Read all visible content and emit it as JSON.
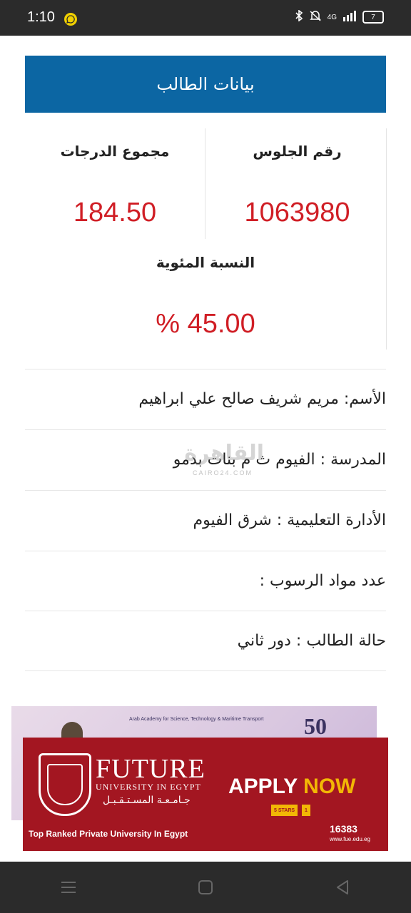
{
  "status_bar": {
    "time": "1:10",
    "battery": "7",
    "network": "4G"
  },
  "header": {
    "title": "بيانات الطالب"
  },
  "stats": {
    "seat_number_label": "رقم الجلوس",
    "seat_number_value": "1063980",
    "total_label": "مجموع الدرجات",
    "total_value": "184.50",
    "percent_label": "النسبة المئوية",
    "percent_value": "% 45.00"
  },
  "details": [
    {
      "text": "الأسم: مريم شريف صالح علي ابراهيم"
    },
    {
      "text": "المدرسة : الفيوم ث م بنات بدمو"
    },
    {
      "text": "الأدارة التعليمية : شرق الفيوم"
    },
    {
      "text": "عدد مواد الرسوب :"
    },
    {
      "text": "حالة الطالب : دور ثاني"
    }
  ],
  "watermark": {
    "text": "القاهرة",
    "sub": "CAIRO24.COM"
  },
  "ad": {
    "back_number": "50",
    "back_text": "Arab Academy for Science, Technology & Maritime Transport",
    "brand": "FUTURE",
    "university": "UNIVERSITY IN EGYPT",
    "university_ar": "جـامـعـة المسـتـقـبـل",
    "apply": "APPLY",
    "now": "NOW",
    "badge_1": "5 STARS",
    "badge_2": "1",
    "tagline": "Top Ranked Private University In Egypt",
    "phone": "16383",
    "site": "www.fue.edu.eg"
  },
  "colors": {
    "header_bg": "#0c66a3",
    "value_red": "#d01e25",
    "ad_red": "#a31621",
    "ad_gold": "#f2b705"
  }
}
